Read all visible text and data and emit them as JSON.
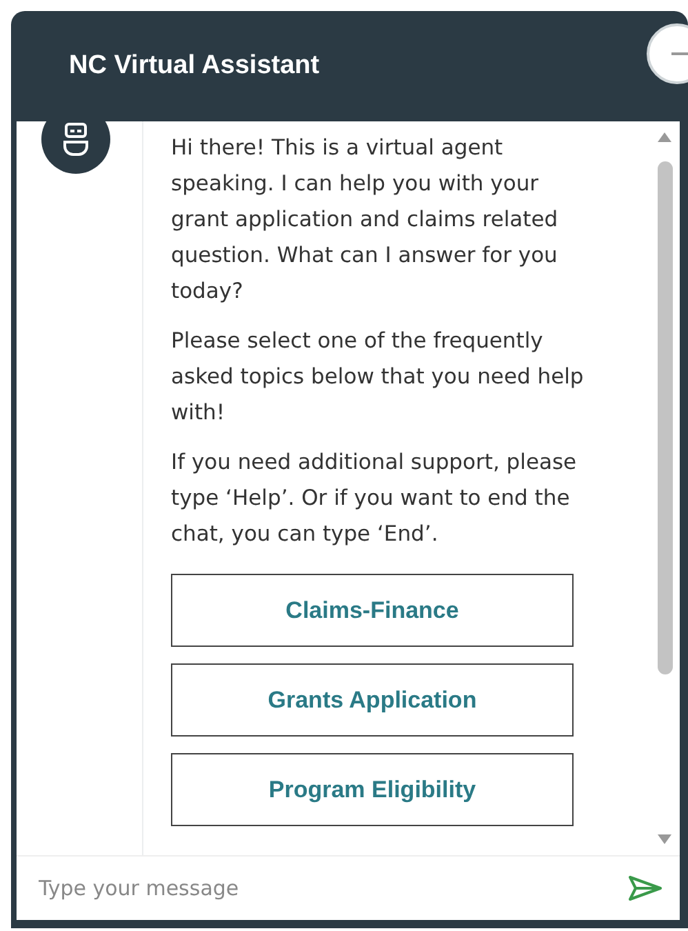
{
  "header": {
    "title": "NC Virtual Assistant"
  },
  "messages": [
    {
      "paragraphs": [
        "Hi there! This is a virtual agent speaking. I can help you with your grant application and claims related question. What can I answer for you today?",
        "Please select one of the frequently asked topics below that you need help with!",
        "If you need additional support, please type ‘Help’. Or if you want to end the chat, you can type ‘End’."
      ],
      "options": [
        "Claims-Finance",
        "Grants Application",
        "Program Eligibility"
      ]
    }
  ],
  "composer": {
    "placeholder": "Type your message"
  }
}
